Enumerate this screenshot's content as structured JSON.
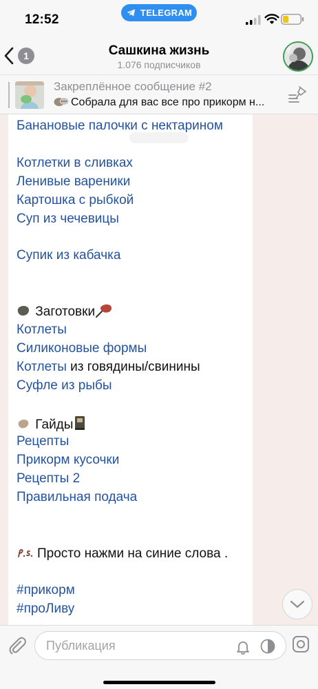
{
  "status_bar": {
    "time": "12:52",
    "app_pill": "TELEGRAM"
  },
  "header": {
    "back_count": "1",
    "title": "Сашкина жизнь",
    "subtitle": "1.076 подписчиков"
  },
  "pinned": {
    "title": "Закреплённое сообщение #2",
    "text": "Собрала для вас все про прикорм н..."
  },
  "message": {
    "lines": [
      "Банановые палочки с нектарином",
      "Котлетки в сливках",
      "Ленивые вареники",
      "Картошка с рыбкой",
      "Суп из чечевицы",
      "Супик из кабачка",
      "Заготовки",
      "Котлеты",
      "Силиконовые формы",
      "Котлеты",
      " из говядины/свинины",
      "Суфле из рыбы",
      "Гайды",
      "Рецепты",
      "Прикорм кусочки",
      "Рецепты 2",
      "Правильная подача",
      "Просто нажми на синие слова .",
      "#прикорм",
      "#проЛиву"
    ]
  },
  "composer": {
    "placeholder": "Публикация"
  },
  "colors": {
    "link": "#24539e",
    "accent": "#2f8ff1",
    "background": "#f6ecea"
  },
  "icons": [
    "telegram-icon",
    "signal-icon",
    "wifi-icon",
    "battery-icon",
    "back-chevron-icon",
    "pinned-list-icon",
    "chevron-down-icon",
    "paperclip-icon",
    "bell-icon",
    "silent-icon",
    "camera-icon"
  ]
}
